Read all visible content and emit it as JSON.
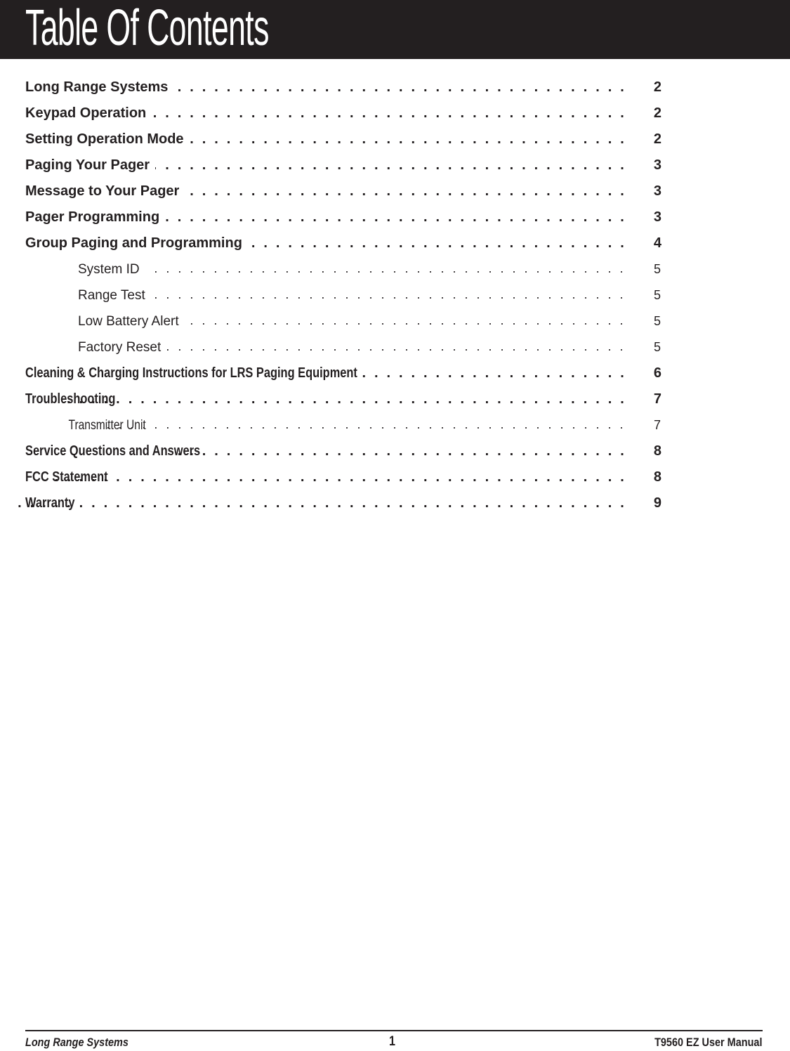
{
  "header": {
    "title": "Table Of Contents"
  },
  "toc": {
    "entries": [
      {
        "label": "Long Range Systems",
        "page": "2",
        "level": 1
      },
      {
        "label": "Keypad Operation",
        "page": "2",
        "level": 1
      },
      {
        "label": "Setting Operation Mode",
        "page": "2",
        "level": 1
      },
      {
        "label": "Paging Your Pager",
        "page": "3",
        "level": 1
      },
      {
        "label": "Message to Your Pager",
        "page": "3",
        "level": 1
      },
      {
        "label": "Pager Programming",
        "page": "3",
        "level": 1
      },
      {
        "label": "Group Paging and Programming",
        "page": "4",
        "level": 1
      },
      {
        "label": "System ID",
        "page": "5",
        "level": 2
      },
      {
        "label": "Range Test",
        "page": "5",
        "level": 2
      },
      {
        "label": "Low Battery Alert",
        "page": "5",
        "level": 2
      },
      {
        "label": "Factory Reset",
        "page": "5",
        "level": 2
      },
      {
        "label": "Cleaning & Charging Instructions for LRS Paging Equipment",
        "page": "6",
        "level": 1
      },
      {
        "label": "Troubleshooting",
        "page": "7",
        "level": 1
      },
      {
        "label": "Transmitter Unit",
        "page": "7",
        "level": 2
      },
      {
        "label": "Service Questions and Answers",
        "page": "8",
        "level": 1
      },
      {
        "label": "FCC Statement",
        "page": "8",
        "level": 1
      },
      {
        "label": "Warranty",
        "page": "9",
        "level": 1
      }
    ]
  },
  "footer": {
    "left": "Long Range Systems",
    "page_number": "1",
    "right": "T9560 EZ User Manual"
  },
  "colors": {
    "header_background": "#231f20",
    "text": "#231f20",
    "header_text": "#ffffff"
  }
}
